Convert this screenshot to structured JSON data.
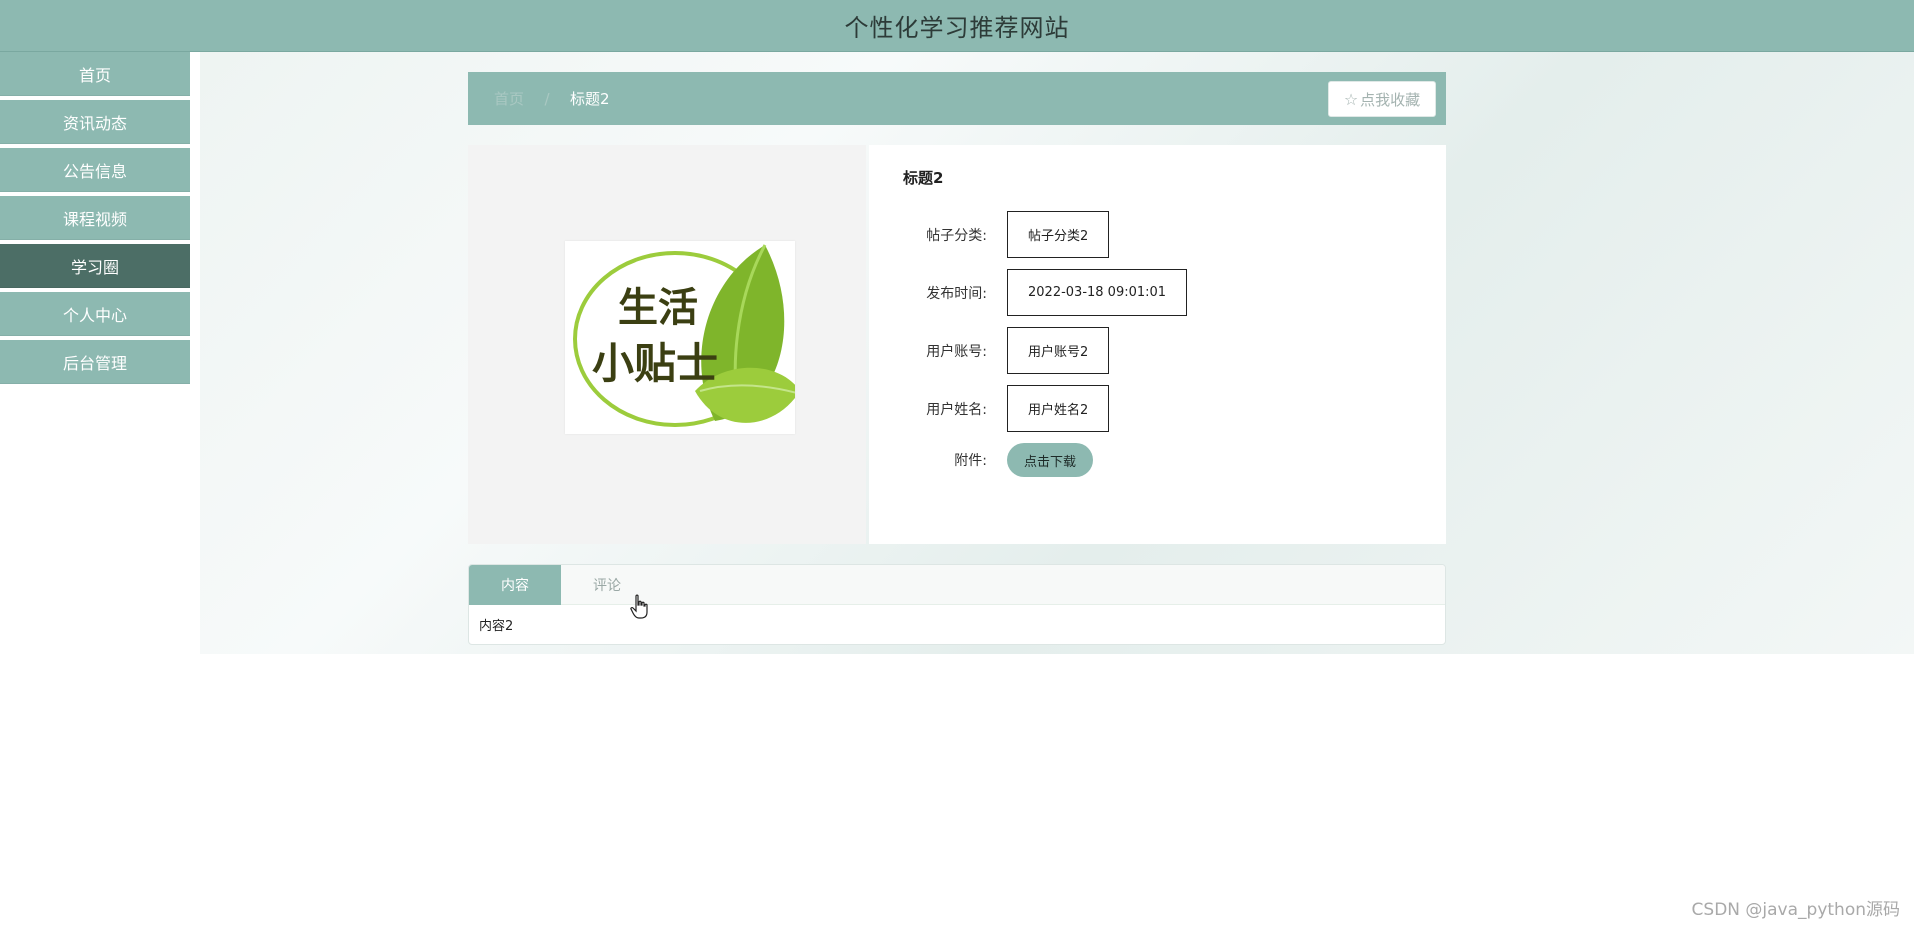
{
  "header": {
    "title": "个性化学习推荐网站"
  },
  "sidebar": {
    "items": [
      {
        "label": "首页"
      },
      {
        "label": "资讯动态"
      },
      {
        "label": "公告信息"
      },
      {
        "label": "课程视频"
      },
      {
        "label": "学习圈",
        "active": true
      },
      {
        "label": "个人中心"
      },
      {
        "label": "后台管理"
      }
    ]
  },
  "breadcrumb": {
    "home": "首页",
    "separator": "/",
    "current": "标题2",
    "favorite_label": "点我收藏",
    "favorite_icon": "star-outline-icon"
  },
  "image": {
    "caption_line1": "生活",
    "caption_line2": "小贴士"
  },
  "details": {
    "title": "标题2",
    "fields": [
      {
        "label": "帖子分类:",
        "value": "帖子分类2"
      },
      {
        "label": "发布时间:",
        "value": "2022-03-18 09:01:01"
      },
      {
        "label": "用户账号:",
        "value": "用户账号2"
      },
      {
        "label": "用户姓名:",
        "value": "用户姓名2"
      }
    ],
    "attachment_label": "附件:",
    "download_label": "点击下载"
  },
  "tabs": {
    "items": [
      {
        "label": "内容",
        "active": true
      },
      {
        "label": "评论"
      }
    ],
    "content": "内容2"
  },
  "watermark": "CSDN @java_python源码",
  "colors": {
    "accent": "#8db9b1",
    "active_nav": "#4c6e66"
  }
}
